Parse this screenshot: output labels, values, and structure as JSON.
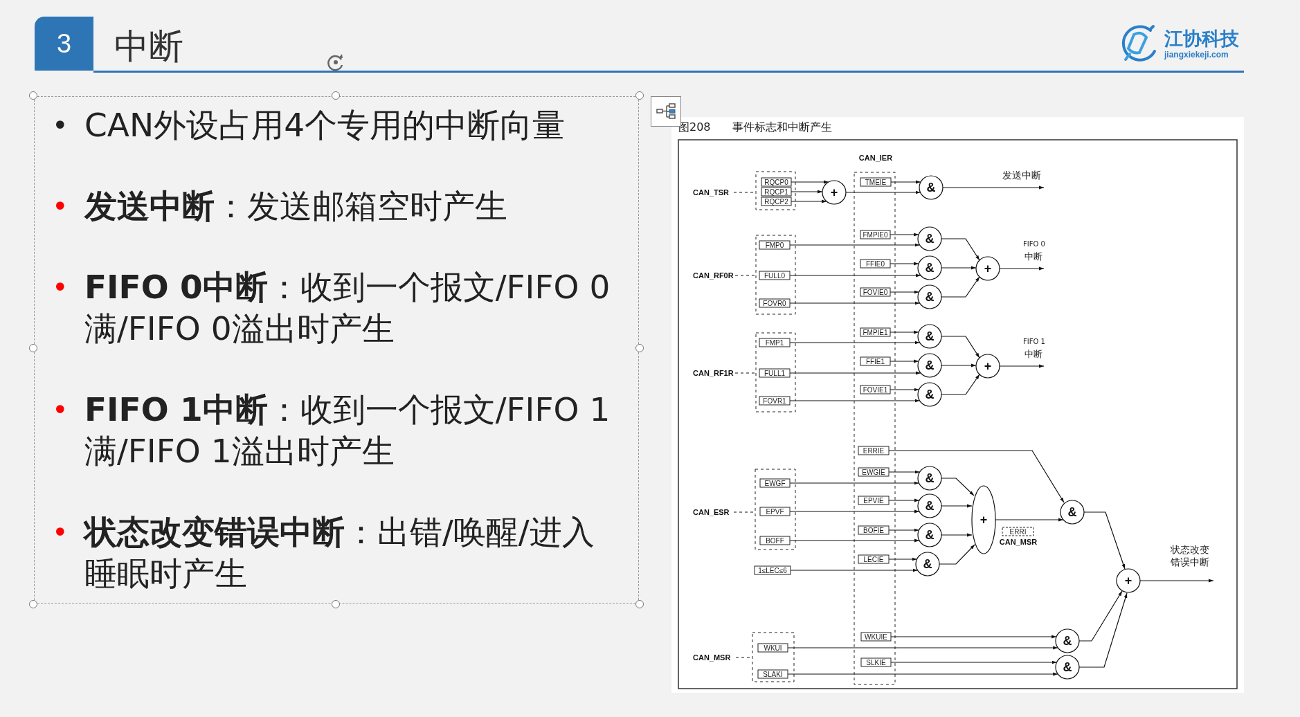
{
  "header": {
    "number": "3",
    "title": "中断"
  },
  "logo": {
    "name": "江协科技",
    "url": "jiangxiekeji.com"
  },
  "bullets": [
    {
      "marker": "•",
      "highlight": false,
      "text": "CAN外设占用4个专用的中断向量"
    },
    {
      "marker": "•",
      "highlight": true,
      "text": "**发送中断**：发送邮箱空时产生"
    },
    {
      "marker": "•",
      "highlight": true,
      "text": "**FIFO 0中断**：收到一个报文/FIFO 0满/FIFO 0溢出时产生"
    },
    {
      "marker": "•",
      "highlight": true,
      "text": "**FIFO 1中断**：收到一个报文/FIFO 1满/FIFO 1溢出时产生"
    },
    {
      "marker": "•",
      "highlight": true,
      "text": "**状态改变错误中断**：出错/唤醒/进入睡眠时产生"
    }
  ],
  "figure": {
    "number": "图208",
    "caption": "事件标志和中断产生",
    "diagram": {
      "enable_register": "CAN_IER",
      "and_symbol": "&",
      "or_symbol": "+",
      "groups": [
        {
          "register": "CAN_TSR",
          "flags": [
            "RQCP0",
            "RQCP1",
            "RQCP2"
          ],
          "enables": [
            "TMEIE"
          ],
          "output": [
            "发送中断"
          ]
        },
        {
          "register": "CAN_RF0R",
          "flags": [
            "FMP0",
            "FULL0",
            "FOVR0"
          ],
          "enables": [
            "FMPIE0",
            "FFIE0",
            "FOVIE0"
          ],
          "output": [
            "FIFO 0",
            "中断"
          ]
        },
        {
          "register": "CAN_RF1R",
          "flags": [
            "FMP1",
            "FULL1",
            "FOVR1"
          ],
          "enables": [
            "FMPIE1",
            "FFIE1",
            "FOVIE1"
          ],
          "output": [
            "FIFO 1",
            "中断"
          ]
        },
        {
          "register": "CAN_ESR",
          "flags": [
            "EWGF",
            "EPVF",
            "BOFF",
            "1≤LEC≤6"
          ],
          "enables": [
            "ERRIE",
            "EWGIE",
            "EPVIE",
            "BOFIE",
            "LECIE"
          ],
          "status_flag": "ERRI",
          "status_register": "CAN_MSR"
        },
        {
          "register": "CAN_MSR",
          "flags": [
            "WKUI",
            "SLAKI"
          ],
          "enables": [
            "WKUIE",
            "SLKIE"
          ],
          "output": [
            "状态改变",
            "错误中断"
          ]
        }
      ]
    }
  }
}
